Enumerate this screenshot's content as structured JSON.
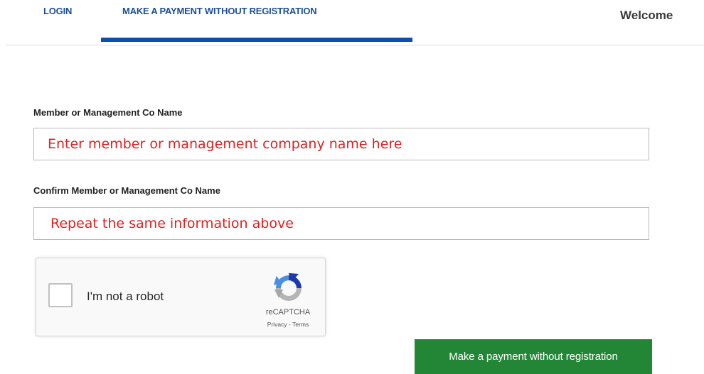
{
  "tabs": {
    "login": "LOGIN",
    "payment": "MAKE A PAYMENT WITHOUT REGISTRATION",
    "active": "payment"
  },
  "header": {
    "welcome": "Welcome"
  },
  "form": {
    "member_label": "Member or Management Co Name",
    "member_placeholder": "Enter member or management company name here",
    "confirm_label": "Confirm Member or Management Co Name",
    "confirm_placeholder": "Repeat the same information above"
  },
  "recaptcha": {
    "checkbox_label": "I'm not a robot",
    "brand": "reCAPTCHA",
    "privacy": "Privacy",
    "separator": " - ",
    "terms": "Terms",
    "logo_icon": "recaptcha-logo-icon",
    "checked": false
  },
  "actions": {
    "submit_label": "Make a payment without registration"
  },
  "colors": {
    "tab_text": "#1d4f91",
    "tab_active_underline": "#0d4fae",
    "placeholder_text": "#e02020",
    "submit_button": "#238636"
  }
}
